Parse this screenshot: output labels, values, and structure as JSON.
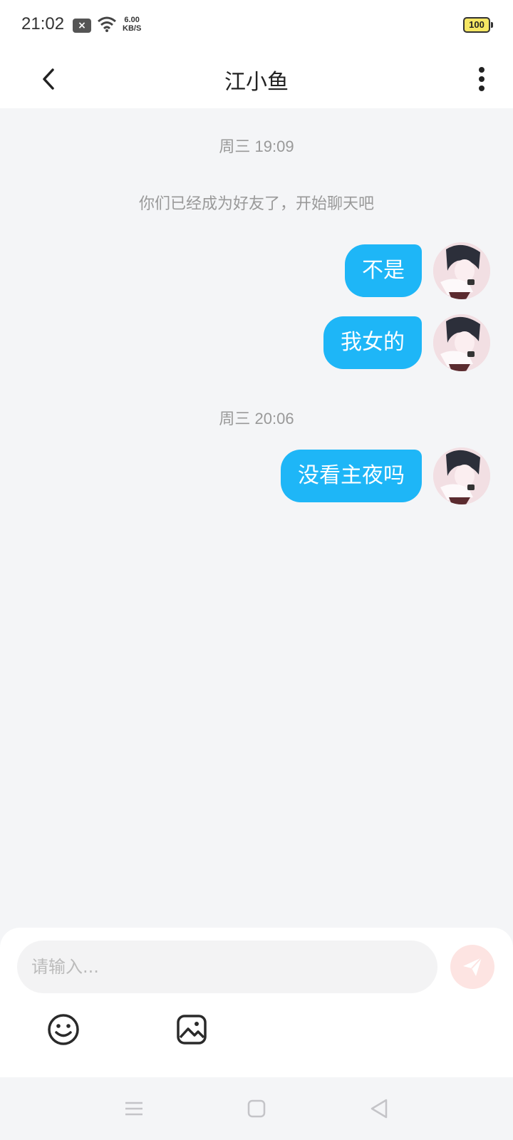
{
  "status_bar": {
    "time": "21:02",
    "notification_icon": "x-icon",
    "net_speed_value": "6.00",
    "net_speed_unit": "KB/S",
    "battery": "100"
  },
  "header": {
    "title": "江小鱼",
    "back_icon": "chevron-left-icon",
    "more_icon": "more-vertical-icon"
  },
  "chat": {
    "timestamps": [
      "周三 19:09",
      "周三 20:06"
    ],
    "system_message": "你们已经成为好友了，开始聊天吧",
    "messages": [
      {
        "text": "不是",
        "from": "self"
      },
      {
        "text": "我女的",
        "from": "self"
      },
      {
        "text": "没看主夜吗",
        "from": "self"
      }
    ]
  },
  "composer": {
    "placeholder": "请输入...",
    "value": "",
    "send_icon": "send-icon",
    "emoji_icon": "emoji-icon",
    "image_icon": "image-icon"
  },
  "colors": {
    "bubble": "#1eb6f7",
    "background": "#f4f5f7",
    "send_button": "#fde4e2"
  }
}
